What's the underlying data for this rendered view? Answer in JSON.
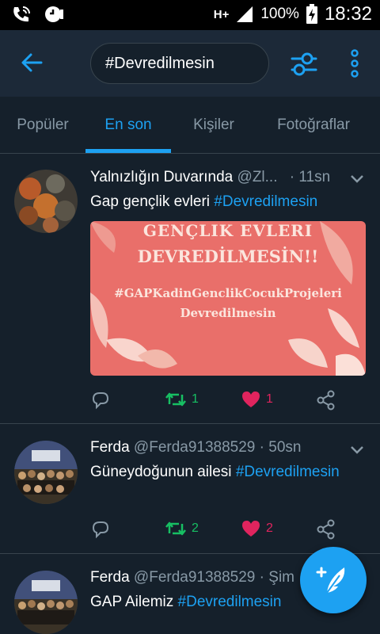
{
  "status": {
    "battery": "100%",
    "time": "18:32",
    "network": "H+"
  },
  "appbar": {
    "search_value": "#Devredilmesin"
  },
  "tabs": [
    "Popüler",
    "En son",
    "Kişiler",
    "Fotoğraflar"
  ],
  "tweets": [
    {
      "name": "Yalnızlığın Duvarında",
      "handle": "@Zl...",
      "time": "· 11sn",
      "text": "Gap gençlik evleri ",
      "hashtag": "#Devredilmesin",
      "retweets": "1",
      "likes": "1",
      "media": {
        "line1": "GENÇLIK EVLERI",
        "line2": "DEVREDİLMESİN!!",
        "line3": "#GAPKadinGenclikCocukProjeleri",
        "line4": "Devredilmesin"
      }
    },
    {
      "name": "Ferda",
      "handle": "@Ferda91388529",
      "time": "· 50sn",
      "text": "Güneydoğunun ailesi  ",
      "hashtag": "#Devredilmesin",
      "retweets": "2",
      "likes": "2"
    },
    {
      "name": "Ferda",
      "handle": "@Ferda91388529",
      "time": "· Şim",
      "text": "GAP Ailemiz  ",
      "hashtag": "#Devredilmesin"
    }
  ],
  "colors": {
    "accent": "#1da1f2",
    "retweet": "#17bf63",
    "like": "#e0245e",
    "background": "#15202b"
  }
}
